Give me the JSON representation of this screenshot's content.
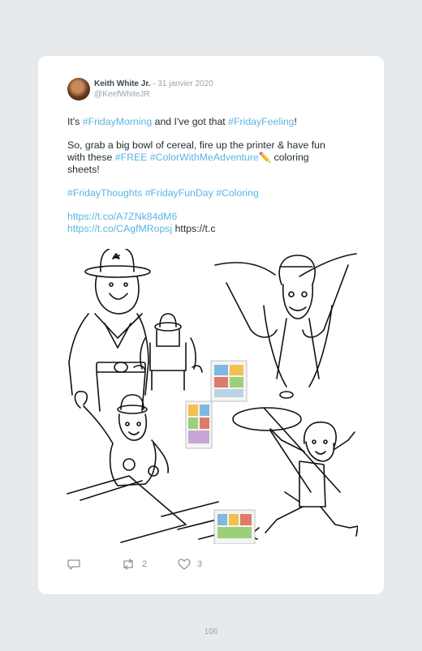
{
  "tweet": {
    "author_name": "Keith White Jr.",
    "separator": " - ",
    "date": "31 janvier 2020",
    "handle": "@KeefWhiteJR",
    "line1_prefix": "It's ",
    "line1_tag1": "#FridayMorning",
    "line1_mid": " and I've got that ",
    "line1_tag2": "#FridayFeeling",
    "line1_suffix": "!",
    "line2_text": "So, grab a big bowl of cereal, fire up the printer & have fun with these ",
    "line2_tag1": "#FREE",
    "line2_space": " ",
    "line2_tag2": "#ColorWithMeAdventure",
    "line2_emoji": "✏️",
    "line2_suffix": " coloring sheets!",
    "tags": [
      "#FridayThoughts",
      "#FridayFunDay",
      "#Coloring"
    ],
    "link1": "https://t.co/A7ZNk84dM6",
    "link2": "https://t.co/CAgfMRopsj",
    "link3": "https://t.c",
    "actions": {
      "retweets": "2",
      "likes": "3"
    }
  },
  "icons": {
    "reply": "reply-icon",
    "retweet": "retweet-icon",
    "like": "heart-icon"
  },
  "colors": {
    "hashtag": "#5bb4e5",
    "background": "#e6eaed",
    "card": "#ffffff"
  },
  "page_number": "106"
}
